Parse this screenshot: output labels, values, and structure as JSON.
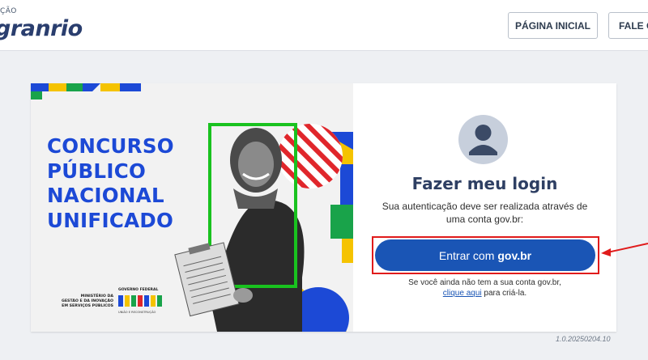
{
  "header": {
    "brand_top": "ÇÃO",
    "brand_name": "granrio",
    "home_button": "PÁGINA INICIAL",
    "contact_button": "FALE CONOSCO"
  },
  "banner": {
    "title_lines": [
      "CONCURSO",
      "PÚBLICO",
      "NACIONAL",
      "UNIFICADO"
    ],
    "ministry_lines": [
      "MINISTÉRIO DA",
      "GESTÃO E DA INOVAÇÃO",
      "EM SERVIÇOS PÚBLICOS"
    ],
    "gov_label": "GOVERNO FEDERAL",
    "gov_word": "BRASIL",
    "gov_sub": "UNIÃO E RECONSTRUÇÃO"
  },
  "login": {
    "title": "Fazer meu login",
    "description": "Sua autenticação deve ser realizada através de uma conta gov.br:",
    "button_prefix": "Entrar com",
    "button_brand": "gov.br",
    "signup_text": "Se você ainda não tem a sua conta gov.br,",
    "signup_link": "clique aqui",
    "signup_suffix": "para criá-la."
  },
  "version": "1.0.20250204.10",
  "colors": {
    "govbr_blue": "#1a55b5",
    "highlight_red": "#e01b1b",
    "banner_blue": "#1c49d6",
    "title_navy": "#2e3f63"
  }
}
